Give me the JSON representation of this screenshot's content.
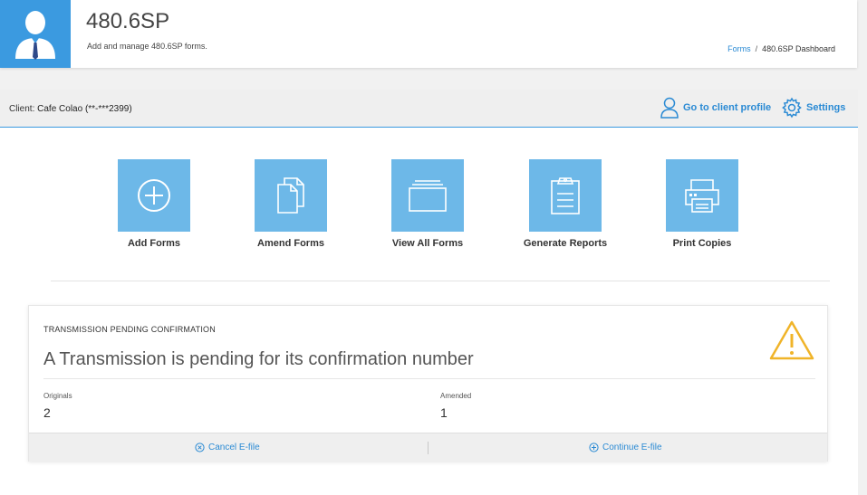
{
  "header": {
    "title": "480.6SP",
    "subtitle": "Add and manage 480.6SP forms.",
    "breadcrumb": {
      "link": "Forms",
      "separator": "/",
      "current": "480.6SP Dashboard"
    }
  },
  "client_bar": {
    "label": "Client:",
    "client_name": "Cafe Colao (**-***2399)",
    "profile_link": "Go to client profile",
    "settings_link": "Settings"
  },
  "tiles": [
    {
      "label": "Add Forms",
      "icon": "plus-circle-icon"
    },
    {
      "label": "Amend Forms",
      "icon": "documents-icon"
    },
    {
      "label": "View All Forms",
      "icon": "folder-stack-icon"
    },
    {
      "label": "Generate Reports",
      "icon": "clipboard-report-icon"
    },
    {
      "label": "Print Copies",
      "icon": "printer-icon"
    }
  ],
  "transmission": {
    "heading": "TRANSMISSION PENDING CONFIRMATION",
    "message": "A Transmission is pending for its confirmation number",
    "originals_label": "Originals",
    "originals_value": "2",
    "amended_label": "Amended",
    "amended_value": "1",
    "cancel_label": "Cancel E-file",
    "continue_label": "Continue E-file"
  },
  "colors": {
    "accent": "#3b9ae0",
    "tile": "#6db8e8",
    "link": "#2a8ad4",
    "warning": "#f0b429"
  }
}
